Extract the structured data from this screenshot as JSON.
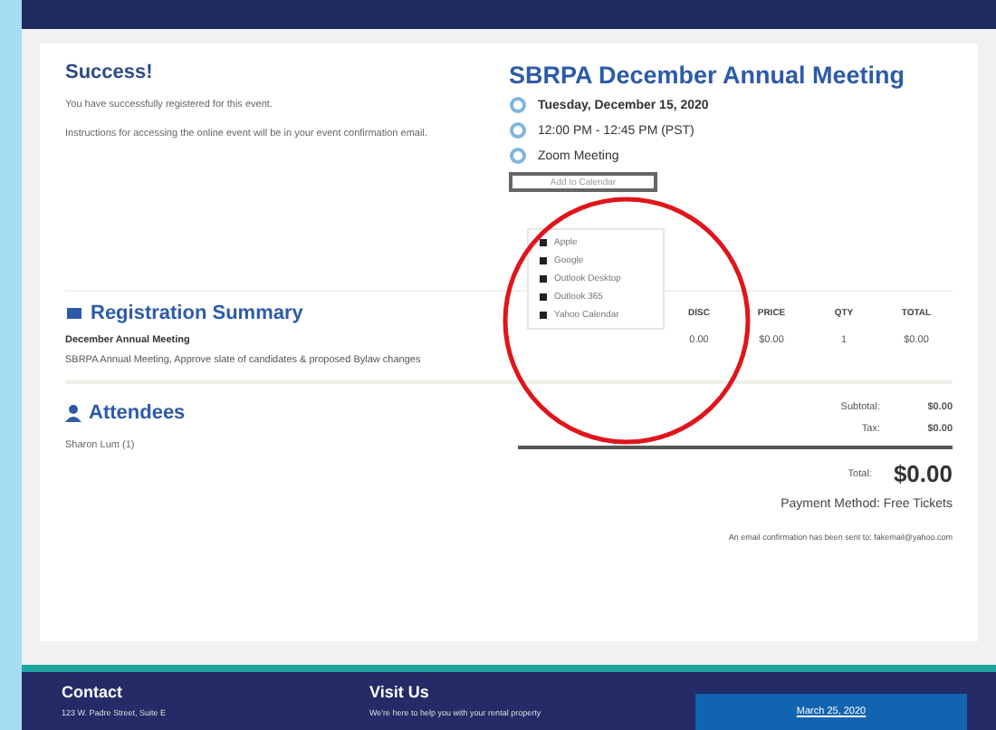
{
  "confirmation": {
    "title": "Success!",
    "message": "You have successfully registered for this event.",
    "instructions": "Instructions for accessing the online event will be in your event confirmation email."
  },
  "event": {
    "title": "SBRPA December Annual Meeting",
    "date": "Tuesday, December 15, 2020",
    "time": "12:00 PM - 12:45 PM (PST)",
    "location": "Zoom Meeting",
    "calendar_button": "Add to Calendar",
    "calendar_menu": [
      {
        "label": "Apple"
      },
      {
        "label": "Google"
      },
      {
        "label": "Outlook Desktop"
      },
      {
        "label": "Outlook 365"
      },
      {
        "label": "Yahoo Calendar"
      }
    ]
  },
  "registration_summary": {
    "title": "Registration Summary",
    "columns": [
      "DISC",
      "PRICE",
      "QTY",
      "TOTAL"
    ],
    "rows": [
      {
        "name": "December Annual Meeting",
        "description": "SBRPA Annual Meeting, Approve slate of candidates & proposed Bylaw changes",
        "cells": [
          "0.00",
          "$0.00",
          "1",
          "$0.00"
        ]
      }
    ]
  },
  "attendees": {
    "title": "Attendees",
    "names": [
      "Sharon Lum (1)"
    ]
  },
  "totals": {
    "subtotal_label": "Subtotal:",
    "subtotal": "$0.00",
    "tax_label": "Tax:",
    "tax": "$0.00",
    "total_label": "Total:",
    "total": "$0.00",
    "payment": "Payment Method: Free Tickets",
    "email_note": "An email confirmation has been sent to: fakemail@yahoo.com"
  },
  "footer": {
    "contact_title": "Contact",
    "contact_line": "123 W. Padre Street, Suite E",
    "visit_title": "Visit Us",
    "visit_line": "We're here to help you with your rental property",
    "button": "March 25, 2020"
  }
}
